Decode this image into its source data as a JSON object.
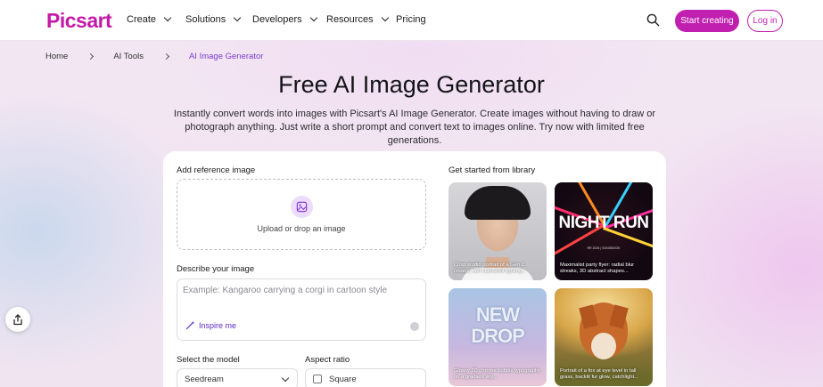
{
  "nav": {
    "logo": "Picsart",
    "items": [
      {
        "label": "Create",
        "dropdown": true
      },
      {
        "label": "Solutions",
        "dropdown": true
      },
      {
        "label": "Developers",
        "dropdown": true
      },
      {
        "label": "Resources",
        "dropdown": true
      },
      {
        "label": "Pricing",
        "dropdown": false
      }
    ],
    "start_label": "Start creating",
    "login_label": "Log in"
  },
  "breadcrumb": [
    "Home",
    "AI Tools",
    "AI Image Generator"
  ],
  "hero": {
    "title": "Free AI Image Generator",
    "subtitle": "Instantly convert words into images with Picsart's AI Image Generator. Create images without having to draw or photograph anything. Just write a short prompt and convert text to images online. Try now with limited free generations."
  },
  "form": {
    "reference_label": "Add reference image",
    "upload_text": "Upload or drop an image",
    "describe_label": "Describe your image",
    "prompt_placeholder": "Example: Kangaroo carrying a corgi in cartoon style",
    "inspire_label": "Inspire me",
    "model_label": "Select the model",
    "model_value": "Seedream",
    "aspect_label": "Aspect ratio",
    "aspect_value": "Square"
  },
  "library": {
    "heading": "Get started from library",
    "tiles": [
      {
        "caption": "Crisp studio portrait of a Gen Z creator, soft clamshell lighting..."
      },
      {
        "caption": "Maximalist party flyer: radial blur streaks, 3D abstract shapes...",
        "art_text": "NIGHT RUN",
        "art_small": "RR 2026 | SONGBOOK"
      },
      {
        "caption": "Glossy 3D chrome bubble typography on a gradient sky...",
        "art_text": "NEW DROP"
      },
      {
        "caption": "Portrait of a fox at eye level in tall grass, backlit fur glow, catchlight..."
      }
    ]
  },
  "colors": {
    "brand": "#c01fb0",
    "accent_text": "#7a3fd2"
  }
}
